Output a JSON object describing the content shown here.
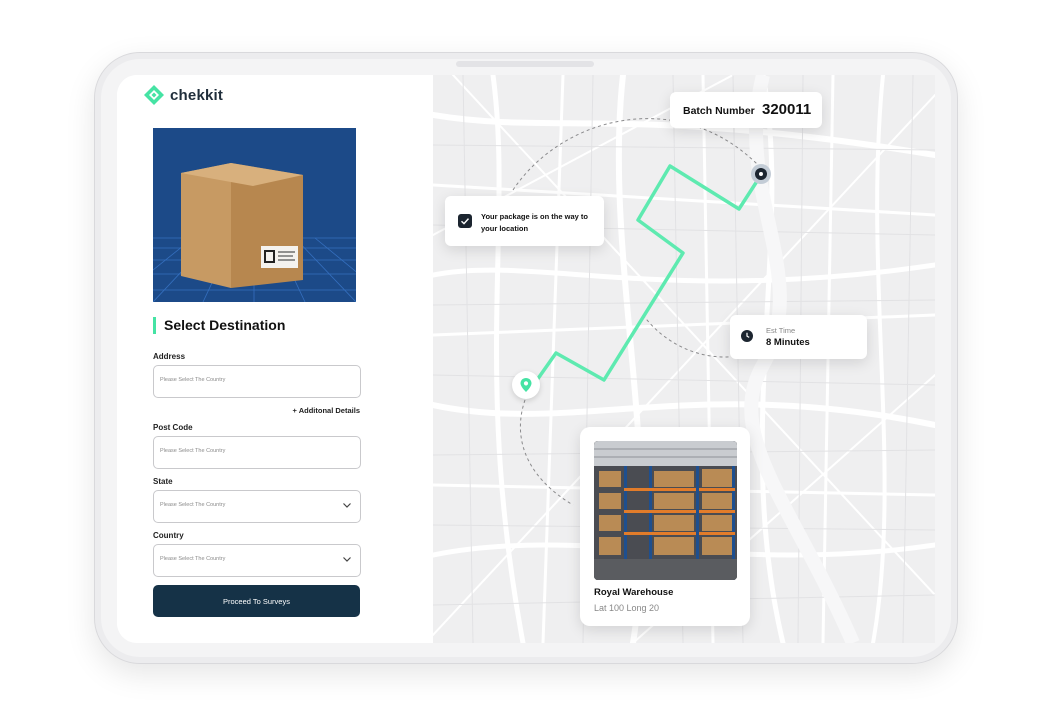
{
  "brand": {
    "name": "chekkit"
  },
  "form": {
    "title": "Select Destination",
    "address": {
      "label": "Address",
      "placeholder": "Please Select The Country"
    },
    "additional_details": "+ Additonal Details",
    "post_code": {
      "label": "Post Code",
      "placeholder": "Please Select The Country"
    },
    "state": {
      "label": "State",
      "placeholder": "Please Select The Country"
    },
    "country": {
      "label": "Country",
      "placeholder": "Please Select The Country"
    },
    "submit_label": "Proceed To Surveys"
  },
  "map": {
    "batch": {
      "label": "Batch Number",
      "value": "320011"
    },
    "status_message": "Your package is on the way to your location",
    "eta": {
      "label": "Est Time",
      "value": "8 Minutes"
    },
    "warehouse": {
      "name": "Royal Warehouse",
      "coords": "Lat 100 Long 20"
    }
  },
  "colors": {
    "accent": "#45e3a4",
    "button": "#153247",
    "product_bg": "#1c4a88",
    "map_bg": "#efeff0"
  },
  "icons": [
    "chekkit-logo",
    "check-icon",
    "clock-icon",
    "location-pin-icon",
    "chevron-down-icon"
  ]
}
